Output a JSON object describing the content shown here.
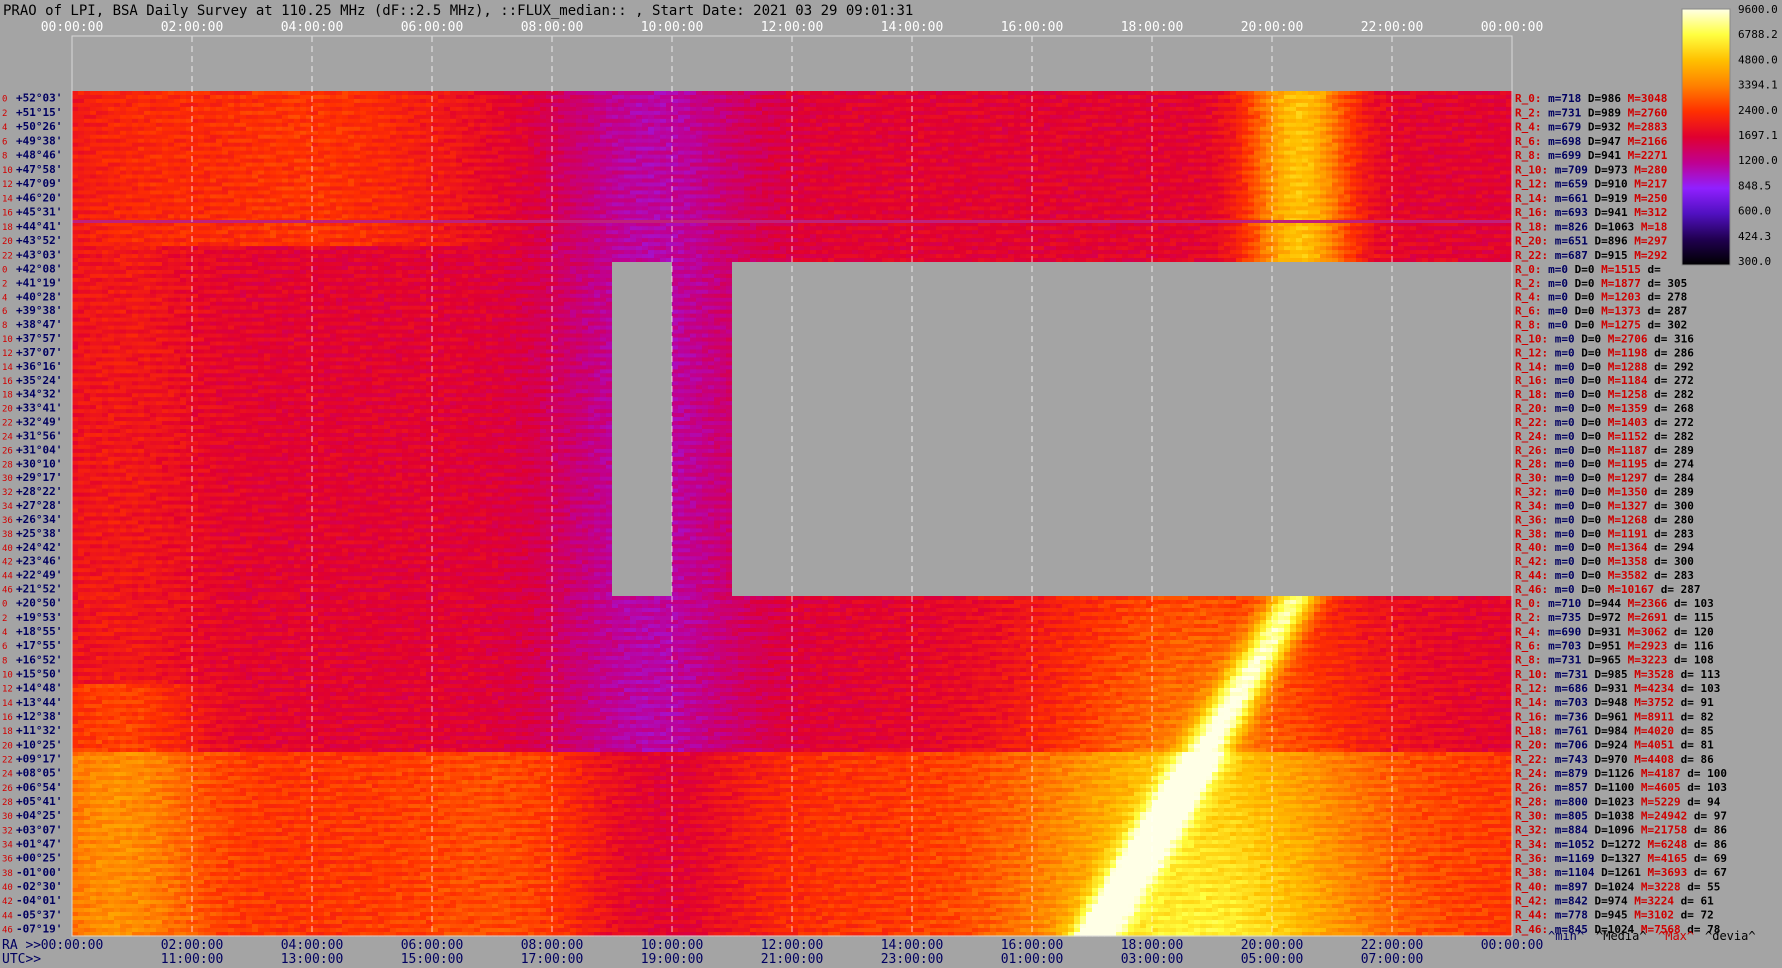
{
  "chart_data": {
    "type": "heatmap",
    "title": "PRAO of LPI, BSA Daily Survey at 110.25 MHz (dF::2.5 MHz), ::FLUX_median:: , Start Date: 2021 03 29 09:01:31",
    "x_top_ticks": [
      "00:00:00",
      "02:00:00",
      "04:00:00",
      "06:00:00",
      "08:00:00",
      "10:00:00",
      "12:00:00",
      "14:00:00",
      "16:00:00",
      "18:00:00",
      "20:00:00",
      "22:00:00",
      "00:00:00"
    ],
    "x_bottom_ra_prefix": "RA >>",
    "x_bottom_ra_ticks": [
      "00:00:00",
      "02:00:00",
      "04:00:00",
      "06:00:00",
      "08:00:00",
      "10:00:00",
      "12:00:00",
      "14:00:00",
      "16:00:00",
      "18:00:00",
      "20:00:00",
      "22:00:00",
      "00:00:00"
    ],
    "x_bottom_utc_prefix": "UTC>>",
    "x_bottom_utc_ticks": [
      "11:00:00",
      "13:00:00",
      "15:00:00",
      "17:00:00",
      "19:00:00",
      "21:00:00",
      "23:00:00",
      "01:00:00",
      "03:00:00",
      "05:00:00",
      "07:00:00"
    ],
    "colorbar": {
      "range": [
        300.0,
        9600.0
      ],
      "tick_labels": [
        "9600.0",
        "6788.2",
        "4800.0",
        "3394.1",
        "2400.0",
        "1697.1",
        "1200.0",
        "848.5",
        "600.0",
        "424.3",
        "300.0"
      ],
      "colors": [
        "#ffffe6",
        "#ffff40",
        "#ffc000",
        "#ff8000",
        "#ff3000",
        "#e00030",
        "#c00090",
        "#9020ff",
        "#5010c0",
        "#200050",
        "#000000"
      ]
    },
    "declination_labels": [
      "+52°03'",
      "+51°15'",
      "+50°26'",
      "+49°38'",
      "+48°46'",
      "+47°58'",
      "+47°09'",
      "+46°20'",
      "+45°31'",
      "+44°41'",
      "+43°52'",
      "+43°03'",
      "+42°08'",
      "+41°19'",
      "+40°28'",
      "+39°38'",
      "+38°47'",
      "+37°57'",
      "+37°07'",
      "+36°16'",
      "+35°24'",
      "+34°32'",
      "+33°41'",
      "+32°49'",
      "+31°56'",
      "+31°04'",
      "+30°10'",
      "+29°17'",
      "+28°22'",
      "+27°28'",
      "+26°34'",
      "+25°38'",
      "+24°42'",
      "+23°46'",
      "+22°49'",
      "+21°52'",
      "+20°50'",
      "+19°53'",
      "+18°55'",
      "+17°55'",
      "+16°52'",
      "+15°50'",
      "+14°48'",
      "+13°44'",
      "+12°38'",
      "+11°32'",
      "+10°25'",
      "+09°17'",
      "+08°05'",
      "+06°54'",
      "+05°41'",
      "+04°25'",
      "+03°07'",
      "+01°47'",
      "+00°25'",
      "-01°00'",
      "-02°30'",
      "-04°01'",
      "-05°37'",
      "-07°19'"
    ],
    "stats_block_1": [
      {
        "r": "R_0:",
        "m": "718",
        "d": "986",
        "h": "3048"
      },
      {
        "r": "R_2:",
        "m": "731",
        "d": "989",
        "h": "2760"
      },
      {
        "r": "R_4:",
        "m": "679",
        "d": "932",
        "h": "2883"
      },
      {
        "r": "R_6:",
        "m": "698",
        "d": "947",
        "h": "2166"
      },
      {
        "r": "R_8:",
        "m": "699",
        "d": "941",
        "h": "2271"
      },
      {
        "r": "R_10:",
        "m": "709",
        "d": "973",
        "h": "280"
      },
      {
        "r": "R_12:",
        "m": "659",
        "d": "910",
        "h": "217"
      },
      {
        "r": "R_14:",
        "m": "661",
        "d": "919",
        "h": "250"
      },
      {
        "r": "R_16:",
        "m": "693",
        "d": "941",
        "h": "312"
      },
      {
        "r": "R_18:",
        "m": "826",
        "d": "1063",
        "h": "18"
      },
      {
        "r": "R_20:",
        "m": "651",
        "d": "896",
        "h": "297"
      },
      {
        "r": "R_22:",
        "m": "687",
        "d": "915",
        "h": "292"
      }
    ],
    "stats_block_2": [
      {
        "r": "R_0:",
        "m": "0",
        "d": "0",
        "h": "1515",
        "dv": ""
      },
      {
        "r": "R_2:",
        "m": "0",
        "d": "0",
        "h": "1877",
        "dv": "305"
      },
      {
        "r": "R_4:",
        "m": "0",
        "d": "0",
        "h": "1203",
        "dv": "278"
      },
      {
        "r": "R_6:",
        "m": "0",
        "d": "0",
        "h": "1373",
        "dv": "287"
      },
      {
        "r": "R_8:",
        "m": "0",
        "d": "0",
        "h": "1275",
        "dv": "302"
      },
      {
        "r": "R_10:",
        "m": "0",
        "d": "0",
        "h": "2706",
        "dv": "316"
      },
      {
        "r": "R_12:",
        "m": "0",
        "d": "0",
        "h": "1198",
        "dv": "286"
      },
      {
        "r": "R_14:",
        "m": "0",
        "d": "0",
        "h": "1288",
        "dv": "292"
      },
      {
        "r": "R_16:",
        "m": "0",
        "d": "0",
        "h": "1184",
        "dv": "272"
      },
      {
        "r": "R_18:",
        "m": "0",
        "d": "0",
        "h": "1258",
        "dv": "282"
      },
      {
        "r": "R_20:",
        "m": "0",
        "d": "0",
        "h": "1359",
        "dv": "268"
      },
      {
        "r": "R_22:",
        "m": "0",
        "d": "0",
        "h": "1403",
        "dv": "272"
      },
      {
        "r": "R_24:",
        "m": "0",
        "d": "0",
        "h": "1152",
        "dv": "282"
      },
      {
        "r": "R_26:",
        "m": "0",
        "d": "0",
        "h": "1187",
        "dv": "289"
      },
      {
        "r": "R_28:",
        "m": "0",
        "d": "0",
        "h": "1195",
        "dv": "274"
      },
      {
        "r": "R_30:",
        "m": "0",
        "d": "0",
        "h": "1297",
        "dv": "284"
      },
      {
        "r": "R_32:",
        "m": "0",
        "d": "0",
        "h": "1350",
        "dv": "289"
      },
      {
        "r": "R_34:",
        "m": "0",
        "d": "0",
        "h": "1327",
        "dv": "300"
      },
      {
        "r": "R_36:",
        "m": "0",
        "d": "0",
        "h": "1268",
        "dv": "280"
      },
      {
        "r": "R_38:",
        "m": "0",
        "d": "0",
        "h": "1191",
        "dv": "283"
      },
      {
        "r": "R_40:",
        "m": "0",
        "d": "0",
        "h": "1364",
        "dv": "294"
      },
      {
        "r": "R_42:",
        "m": "0",
        "d": "0",
        "h": "1358",
        "dv": "300"
      },
      {
        "r": "R_44:",
        "m": "0",
        "d": "0",
        "h": "3582",
        "dv": "283"
      },
      {
        "r": "R_46:",
        "m": "0",
        "d": "0",
        "h": "10167",
        "dv": "287"
      }
    ],
    "stats_block_3": [
      {
        "r": "R_0:",
        "m": "710",
        "d": "944",
        "h": "2366",
        "dv": "103"
      },
      {
        "r": "R_2:",
        "m": "735",
        "d": "972",
        "h": "2691",
        "dv": "115"
      },
      {
        "r": "R_4:",
        "m": "690",
        "d": "931",
        "h": "3062",
        "dv": "120"
      },
      {
        "r": "R_6:",
        "m": "703",
        "d": "951",
        "h": "2923",
        "dv": "116"
      },
      {
        "r": "R_8:",
        "m": "731",
        "d": "965",
        "h": "3223",
        "dv": "108"
      },
      {
        "r": "R_10:",
        "m": "731",
        "d": "985",
        "h": "3528",
        "dv": "113"
      },
      {
        "r": "R_12:",
        "m": "686",
        "d": "931",
        "h": "4234",
        "dv": "103"
      },
      {
        "r": "R_14:",
        "m": "703",
        "d": "948",
        "h": "3752",
        "dv": "91"
      },
      {
        "r": "R_16:",
        "m": "736",
        "d": "961",
        "h": "8911",
        "dv": "82"
      },
      {
        "r": "R_18:",
        "m": "761",
        "d": "984",
        "h": "4020",
        "dv": "85"
      },
      {
        "r": "R_20:",
        "m": "706",
        "d": "924",
        "h": "4051",
        "dv": "81"
      },
      {
        "r": "R_22:",
        "m": "743",
        "d": "970",
        "h": "4408",
        "dv": "86"
      },
      {
        "r": "R_24:",
        "m": "879",
        "d": "1126",
        "h": "4187",
        "dv": "100"
      },
      {
        "r": "R_26:",
        "m": "857",
        "d": "1100",
        "h": "4605",
        "dv": "103"
      },
      {
        "r": "R_28:",
        "m": "800",
        "d": "1023",
        "h": "5229",
        "dv": "94"
      },
      {
        "r": "R_30:",
        "m": "805",
        "d": "1038",
        "h": "24942",
        "dv": "97"
      },
      {
        "r": "R_32:",
        "m": "884",
        "d": "1096",
        "h": "21758",
        "dv": "86"
      },
      {
        "r": "R_34:",
        "m": "1052",
        "d": "1272",
        "h": "6248",
        "dv": "86"
      },
      {
        "r": "R_36:",
        "m": "1169",
        "d": "1327",
        "h": "4165",
        "dv": "69"
      },
      {
        "r": "R_38:",
        "m": "1104",
        "d": "1261",
        "h": "3693",
        "dv": "67"
      },
      {
        "r": "R_40:",
        "m": "897",
        "d": "1024",
        "h": "3228",
        "dv": "55"
      },
      {
        "r": "R_42:",
        "m": "842",
        "d": "974",
        "h": "3224",
        "dv": "61"
      },
      {
        "r": "R_44:",
        "m": "778",
        "d": "945",
        "h": "3102",
        "dv": "72"
      },
      {
        "r": "R_46:",
        "m": "845",
        "d": "1024",
        "h": "7568",
        "dv": "78"
      }
    ],
    "footer_legend": {
      "min": "^min^",
      "median": "^Media^",
      "max": "^Max^",
      "devia": "^devia^"
    },
    "colors": {
      "background": "#a4a4a4",
      "label_red": "#d00000",
      "label_navy": "#000060",
      "label_black": "#000000"
    }
  }
}
